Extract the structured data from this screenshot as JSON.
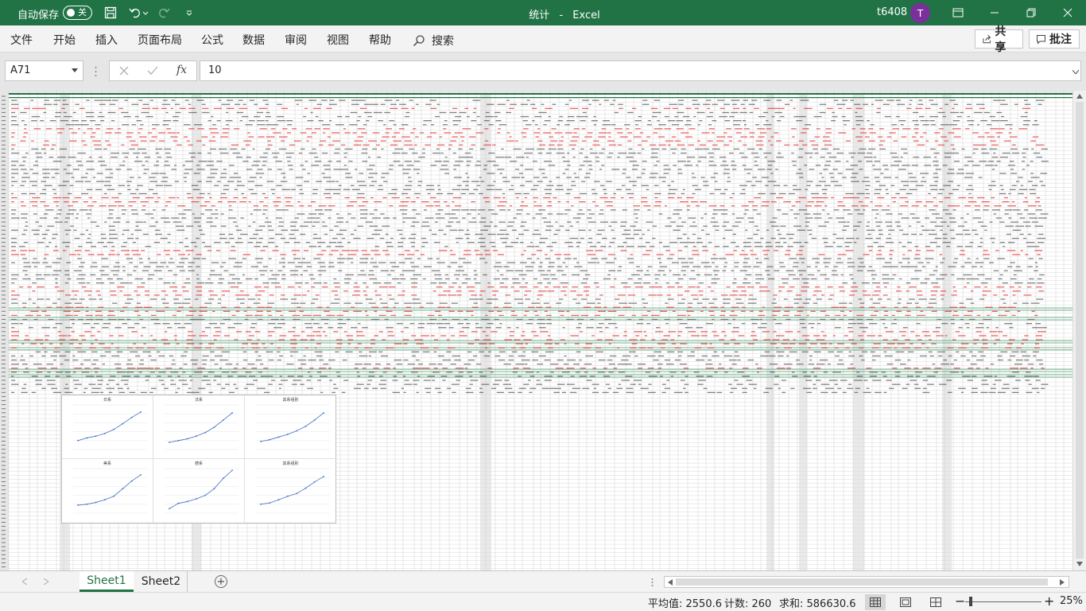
{
  "titlebar": {
    "autosave_label": "自动保存",
    "autosave_state": "关",
    "doc_title": "统计",
    "app_name": "Excel",
    "title_separator": "-",
    "user_name": "t6408",
    "avatar_initial": "T"
  },
  "menu": {
    "items": [
      "文件",
      "开始",
      "插入",
      "页面布局",
      "公式",
      "数据",
      "审阅",
      "视图",
      "帮助"
    ],
    "search_label": "搜索",
    "share_label": "共享",
    "comment_label": "批注"
  },
  "formula_bar": {
    "name_box": "A71",
    "fx_label": "fx",
    "value": "10"
  },
  "sheet": {
    "zoom": "25%",
    "charts": [
      {
        "title": "日系"
      },
      {
        "title": "法系"
      },
      {
        "title": "其系组别"
      },
      {
        "title": "美系"
      },
      {
        "title": "德系"
      },
      {
        "title": "其系组别"
      }
    ]
  },
  "tabs": {
    "sheets": [
      "Sheet1",
      "Sheet2"
    ],
    "active": "Sheet1",
    "add_label": "+"
  },
  "status": {
    "average": "平均值: 2550.6",
    "count": "计数: 260",
    "sum": "求和: 586630.6",
    "zoom": "25%"
  },
  "colors": {
    "brand": "#217346",
    "avatar": "#7b2f9b",
    "red_text": "#e03030",
    "chart_line": "#4472c4"
  }
}
